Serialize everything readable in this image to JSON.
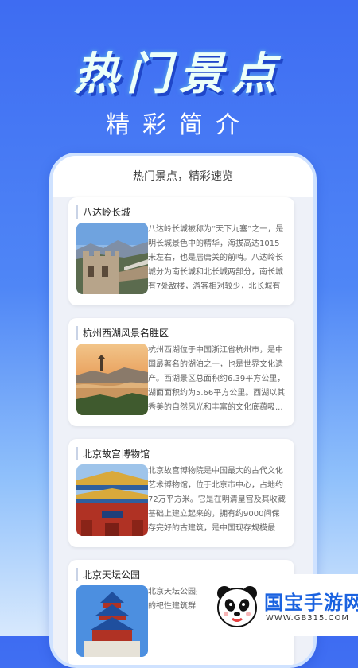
{
  "hero": {
    "title": "热门景点",
    "subtitle": "精彩简介"
  },
  "screen": {
    "header": "热门景点，精彩速览"
  },
  "cards": [
    {
      "title": "八达岭长城",
      "desc": "八达岭长城被称为“天下九塞”之一，是明长城景色中的精华，海拔高达1015米左右，也是居庸关的前哨。八达岭长城分为南长城和北长城两部分，南长城有7处敌楼，游客相对较少，北长城有12..."
    },
    {
      "title": "杭州西湖风景名胜区",
      "desc": "杭州西湖位于中国浙江省杭州市，是中国最著名的湖泊之一，也是世界文化遗产。西湖景区总面积约6.39平方公里，湖面面积约为5.66平方公里。西湖以其秀美的自然风光和丰富的文化底蕴吸..."
    },
    {
      "title": "北京故宫博物馆",
      "desc": "北京故宫博物院是中国最大的古代文化艺术博物馆，位于北京市中心，占地约72万平方米。它是在明清皇宫及其收藏基础上建立起来的，拥有约9000间保存完好的古建筑，是中国现存规模最大..."
    },
    {
      "title": "北京天坛公园",
      "desc": "北京天坛公园是明清两代帝王祭天祈谷的祀性建筑群，位于北京市东城区..."
    }
  ],
  "watermark": {
    "brand": "国宝手游网",
    "url": "WWW.GB315.COM"
  }
}
